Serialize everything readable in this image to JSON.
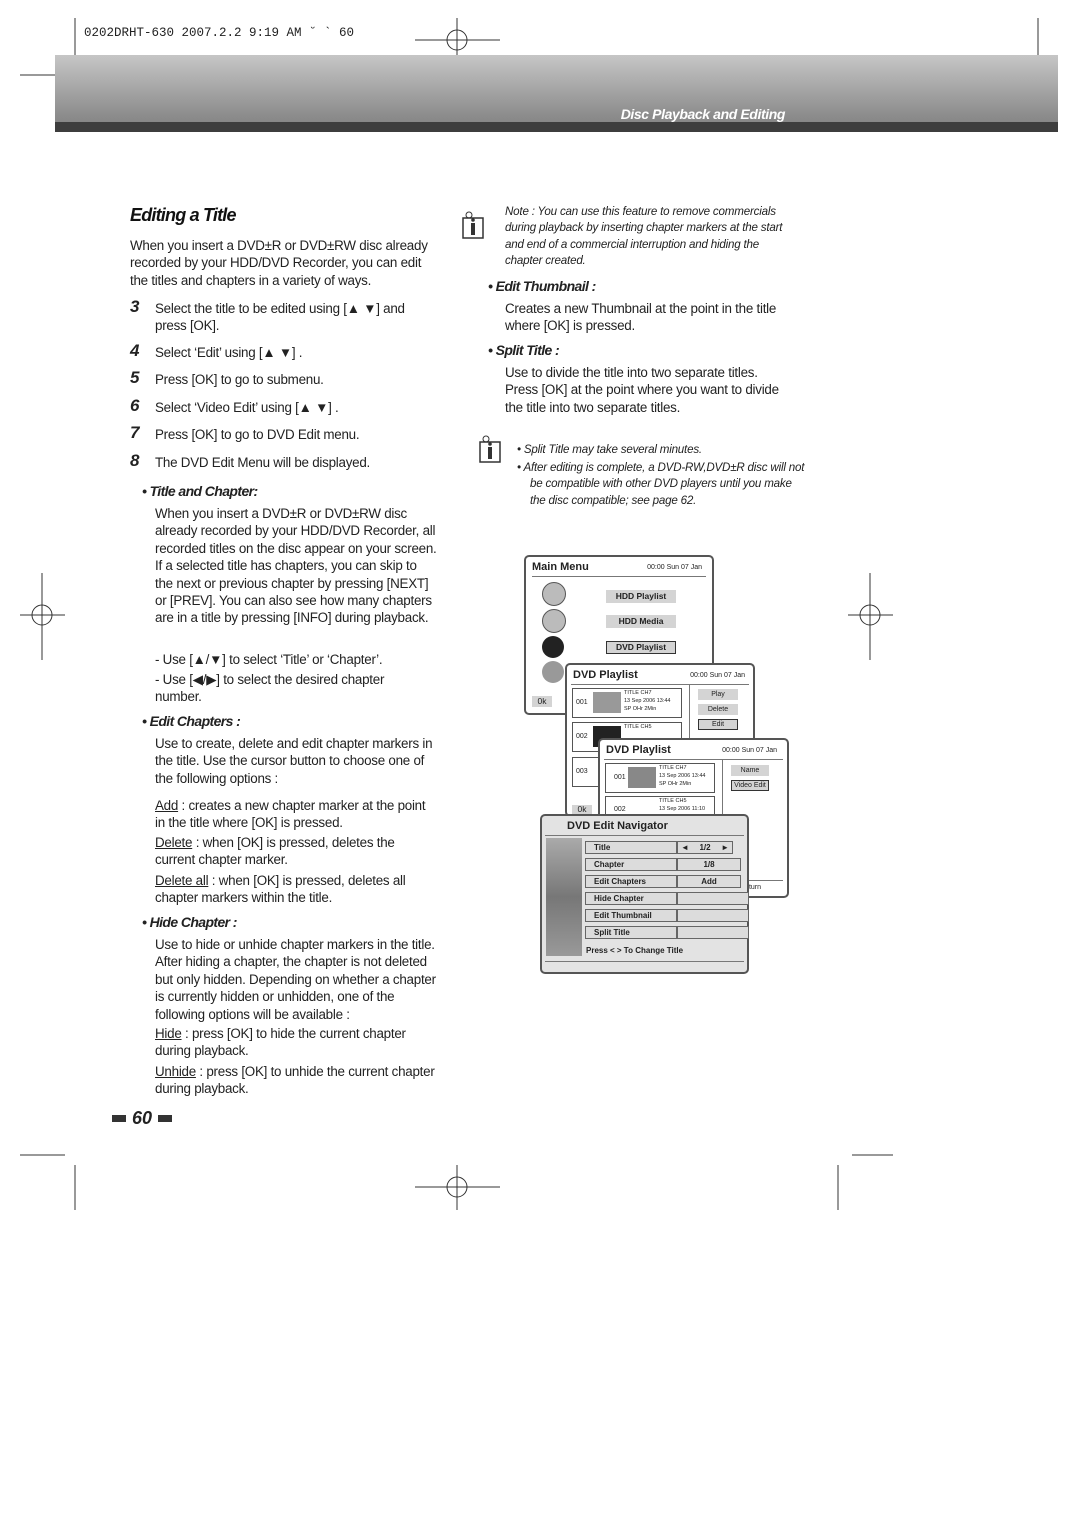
{
  "slug": "0202DRHT-630 2007.2.2 9:19 AM ˘ ` 60",
  "section_title": "Disc Playback and Editing",
  "heading": "Editing a Title",
  "intro": "When you insert a DVD±R or DVD±RW disc already recorded by your HDD/DVD Recorder, you can edit the titles and chapters in a variety of ways.",
  "steps": [
    {
      "n": "3",
      "text": "Select the title to be edited using [▲ ▼] and press [OK]."
    },
    {
      "n": "4",
      "text": "Select ‘Edit’ using [▲ ▼] ."
    },
    {
      "n": "5",
      "text": "Press [OK] to go to submenu."
    },
    {
      "n": "6",
      "text": "Select ‘Video Edit’ using [▲ ▼] ."
    },
    {
      "n": "7",
      "text": "Press [OK] to go to DVD Edit menu."
    },
    {
      "n": "8",
      "text": "The DVD Edit Menu will be displayed."
    }
  ],
  "title_chapter": {
    "heading": "• Title and Chapter:",
    "text": "When you insert a DVD±R or DVD±RW disc already recorded by your HDD/DVD Recorder, all recorded titles on the disc appear on your screen. If a selected title has chapters, you can skip to the next or previous chapter by pressing [NEXT] or [PREV]. You can also see how many chapters are in a title by pressing [INFO] during playback.",
    "use1": "- Use [▲/▼] to select ‘Title’ or ‘Chapter’.",
    "use2": "- Use [◀/▶] to select the desired chapter number."
  },
  "edit_chapters": {
    "heading": "• Edit Chapters :",
    "text": "Use to create, delete and edit chapter markers in the title. Use the cursor button to choose one of the following options :",
    "options": [
      {
        "term": "Add",
        "desc": " : creates a new chapter marker at the point in the title where [OK] is pressed."
      },
      {
        "term": "Delete",
        "desc": " : when [OK] is pressed, deletes the current chapter marker."
      },
      {
        "term": "Delete all",
        "desc": " : when [OK] is pressed, deletes all chapter markers within the title."
      }
    ]
  },
  "hide_chapter": {
    "heading": "• Hide Chapter :",
    "text": "Use to hide or unhide chapter markers in the title. After hiding a chapter, the chapter is not deleted but only hidden. Depending on whether a chapter is currently hidden or unhidden, one of the following options will be available :",
    "options": [
      {
        "term": "Hide",
        "desc": " : press [OK] to hide the current chapter during playback."
      },
      {
        "term": "Unhide",
        "desc": " : press [OK] to unhide the current chapter during playback."
      }
    ]
  },
  "note1": "Note : You can use this feature to remove commercials during playback by inserting chapter markers at the start and end of a commercial interruption and hiding the chapter created.",
  "edit_thumbnail": {
    "heading": "• Edit Thumbnail :",
    "text": "Creates a new Thumbnail at the point in the title where [OK] is pressed."
  },
  "split_title": {
    "heading": "• Split Title :",
    "text": "Use to divide the title into two separate titles. Press [OK] at the point where you want to divide the title into two separate titles."
  },
  "note2": [
    "•  Split Title may take several minutes.",
    "•  After editing is complete, a DVD-RW,DVD±R disc will not be compatible with other DVD players until you make the disc compatible; see page 62."
  ],
  "page_number": "60",
  "screens": {
    "main_menu": {
      "title": "Main Menu",
      "time": "00:00 Sun 07 Jan",
      "items": [
        "HDD Playlist",
        "HDD Media",
        "DVD Playlist"
      ],
      "ok": "0k"
    },
    "playlist1": {
      "title": "DVD Playlist",
      "time": "00:00 Sun 07 Jan",
      "rows": [
        {
          "n": "001",
          "name": "TITLE CH7",
          "date": "13 Sep 2006 13:44",
          "info": "SP  OHr  2Min"
        },
        {
          "n": "002",
          "name": "TITLE CH5"
        },
        {
          "n": "003"
        }
      ],
      "buttons": [
        "Play",
        "Delete",
        "Edit"
      ],
      "ok": "0k"
    },
    "playlist2": {
      "title": "DVD Playlist",
      "time": "00:00 Sun 07 Jan",
      "rows": [
        {
          "n": "001",
          "name": "TITLE CH7",
          "date": "13 Sep 2006 13:44",
          "info": "SP  OHr  2Min"
        },
        {
          "n": "002",
          "name": "TITLE CH5",
          "date": "13 Sep 2006 11:10"
        }
      ],
      "buttons": [
        "Name",
        "Video Edit"
      ],
      "return": "Return"
    },
    "navigator": {
      "title": "DVD Edit Navigator",
      "rows": [
        {
          "label": "Title",
          "value": "1/2"
        },
        {
          "label": "Chapter",
          "value": "1/8"
        },
        {
          "label": "Edit Chapters",
          "value": "Add"
        },
        {
          "label": "Hide Chapter",
          "value": ""
        },
        {
          "label": "Edit Thumbnail",
          "value": ""
        },
        {
          "label": "Split Title",
          "value": ""
        }
      ],
      "hint": "Press < > To  Change Title"
    }
  }
}
